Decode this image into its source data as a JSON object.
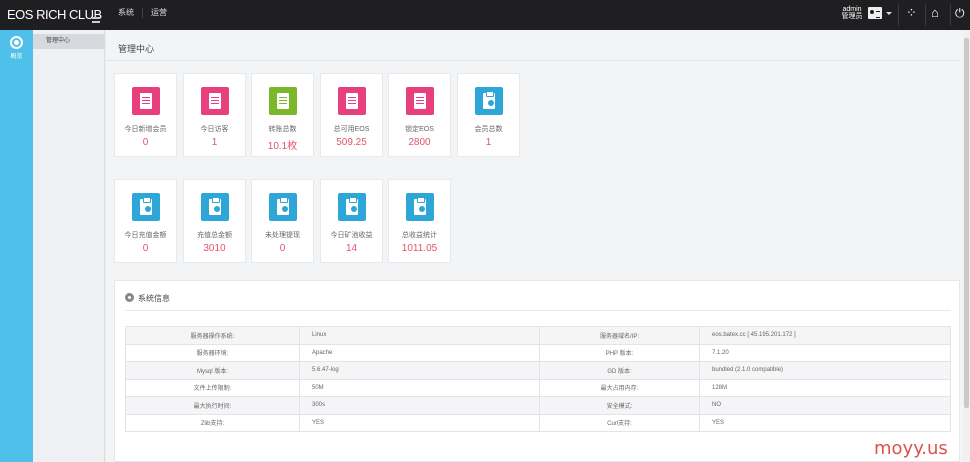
{
  "header": {
    "brand": "EOS RICH CLUB",
    "nav": [
      "系统",
      "运营"
    ],
    "admin_name": "admin",
    "admin_role": "管理员"
  },
  "sidebar": {
    "items": [
      {
        "label": "概览",
        "icon": "dashboard-icon"
      }
    ]
  },
  "submenu": {
    "items": [
      {
        "label": "管理中心"
      }
    ]
  },
  "main": {
    "title": "管理中心",
    "stats_row1": [
      {
        "label": "今日新增会员",
        "value": "0",
        "icon": "document-icon",
        "color": "#e8407c"
      },
      {
        "label": "今日访客",
        "value": "1",
        "icon": "document-icon",
        "color": "#e8407c"
      },
      {
        "label": "转账总数",
        "value": "10.1枚",
        "icon": "notebook-icon",
        "color": "#7cb72a"
      },
      {
        "label": "总可用EOS",
        "value": "509.25",
        "icon": "document-icon",
        "color": "#e8407c"
      },
      {
        "label": "锁定EOS",
        "value": "2800",
        "icon": "document-icon",
        "color": "#e8407c"
      },
      {
        "label": "会员总数",
        "value": "1",
        "icon": "clipboard-check-icon",
        "color": "#2ea7d8"
      }
    ],
    "stats_row2": [
      {
        "label": "今日充值金额",
        "value": "0",
        "icon": "clipboard-check-icon",
        "color": "#2ea7d8"
      },
      {
        "label": "充值总金额",
        "value": "3010",
        "icon": "clipboard-check-icon",
        "color": "#2ea7d8"
      },
      {
        "label": "未处理提现",
        "value": "0",
        "icon": "clipboard-check-icon",
        "color": "#2ea7d8"
      },
      {
        "label": "今日矿池收益",
        "value": "14",
        "icon": "clipboard-check-icon",
        "color": "#2ea7d8"
      },
      {
        "label": "总收益统计",
        "value": "1011.05",
        "icon": "clipboard-check-icon",
        "color": "#2ea7d8"
      }
    ]
  },
  "system_info": {
    "title": "系统信息",
    "rows": [
      {
        "k1": "服务器操作系统:",
        "v1": "Linux",
        "k2": "服务器域名/IP:",
        "v2": "eos.batex.cc [ 45.195.201.172 ]"
      },
      {
        "k1": "服务器环境:",
        "v1": "Apache",
        "k2": "PHP 版本:",
        "v2": "7.1.20"
      },
      {
        "k1": "Mysql 版本:",
        "v1": "5.6.47-log",
        "k2": "GD 版本:",
        "v2": "bundled (2.1.0 compatible)"
      },
      {
        "k1": "文件上传限制:",
        "v1": "50M",
        "k2": "最大占用内存:",
        "v2": "128M"
      },
      {
        "k1": "最大执行时间:",
        "v1": "300s",
        "k2": "安全模式:",
        "v2": "NO"
      },
      {
        "k1": "Zlib支持:",
        "v1": "YES",
        "k2": "Curl支持:",
        "v2": "YES"
      }
    ]
  },
  "watermark": "moyy.us"
}
